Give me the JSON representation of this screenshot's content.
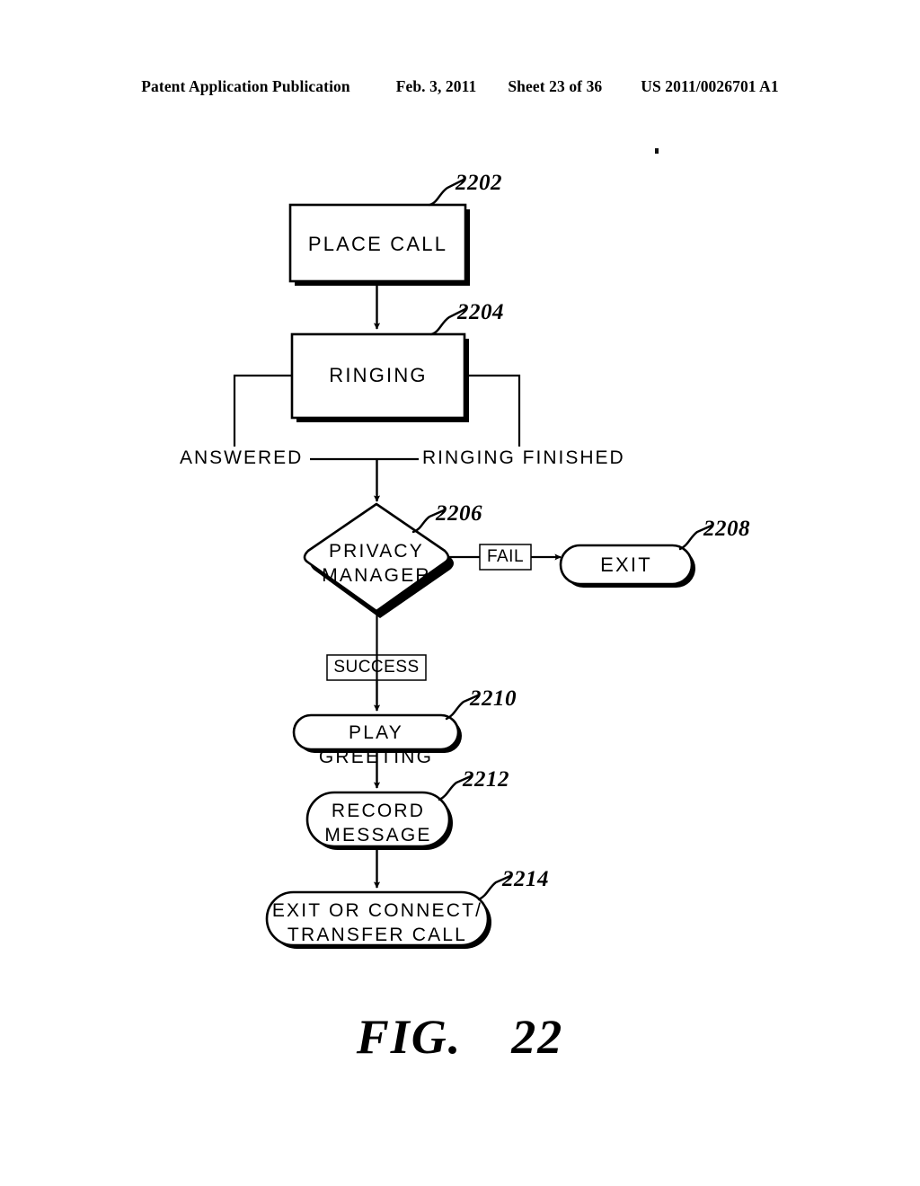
{
  "header": {
    "publication": "Patent Application Publication",
    "date": "Feb. 3, 2011",
    "sheet": "Sheet 23 of 36",
    "pub_number": "US 2011/0026701 A1"
  },
  "figure": {
    "caption_prefix": "FIG.",
    "caption_number": "22",
    "ink_color": "#000000",
    "background_color": "#ffffff"
  },
  "diagram": {
    "type": "flowchart",
    "nodes": [
      {
        "id": "n2202",
        "ref": "2202",
        "label": "PLACE CALL",
        "shape": "rectangle-shadow"
      },
      {
        "id": "n2204",
        "ref": "2204",
        "label": "RINGING",
        "shape": "rectangle-shadow"
      },
      {
        "id": "n2206",
        "ref": "2206",
        "label": "PRIVACY\nMANAGER",
        "shape": "diamond"
      },
      {
        "id": "n2208",
        "ref": "2208",
        "label": "EXIT",
        "shape": "stadium"
      },
      {
        "id": "n2210",
        "ref": "2210",
        "label": "PLAY GREETING",
        "shape": "stadium"
      },
      {
        "id": "n2212",
        "ref": "2212",
        "label": "RECORD\nMESSAGE",
        "shape": "stadium"
      },
      {
        "id": "n2214",
        "ref": "2214",
        "label": "EXIT OR CONNECT/\nTRANSFER CALL",
        "shape": "stadium"
      }
    ],
    "edge_labels": {
      "answered": "ANSWERED",
      "ringing_finished": "RINGING FINISHED",
      "fail": "FAIL",
      "success": "SUCCESS"
    },
    "edges": [
      {
        "from": "n2202",
        "to": "n2204",
        "label": ""
      },
      {
        "from": "n2204",
        "to": "n2206",
        "label": "ANSWERED / RINGING FINISHED"
      },
      {
        "from": "n2206",
        "to": "n2208",
        "label": "FAIL"
      },
      {
        "from": "n2206",
        "to": "n2210",
        "label": "SUCCESS"
      },
      {
        "from": "n2210",
        "to": "n2212",
        "label": ""
      },
      {
        "from": "n2212",
        "to": "n2214",
        "label": ""
      }
    ]
  }
}
